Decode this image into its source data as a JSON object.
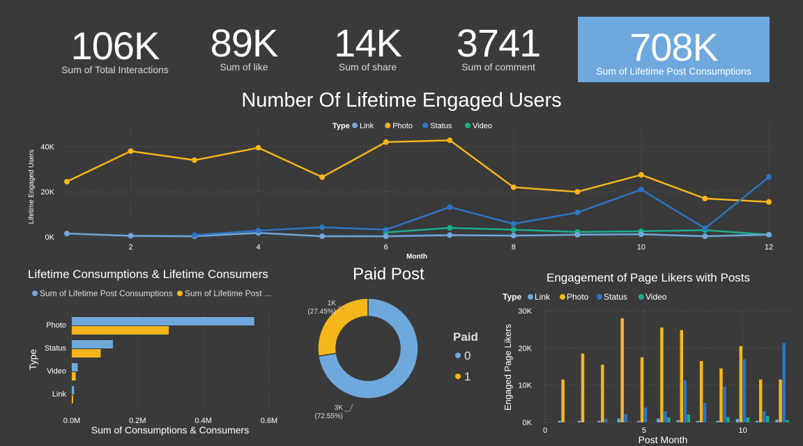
{
  "kpis": [
    {
      "value": "106K",
      "label": "Sum of Total Interactions"
    },
    {
      "value": "89K",
      "label": "Sum of like"
    },
    {
      "value": "14K",
      "label": "Sum of share"
    },
    {
      "value": "3741",
      "label": "Sum of comment"
    },
    {
      "value": "708K",
      "label": "Sum of Lifetime Post Consumptions"
    }
  ],
  "colors": {
    "background": "#3a3a3a",
    "link": "#6fa8dc",
    "photo": "#f4b61a",
    "status": "#2e75c2",
    "video": "#1aae8c",
    "kpi_highlight": "#6fa8dc"
  },
  "line_chart": {
    "title": "Number Of Lifetime Engaged Users",
    "legend_title": "Type",
    "xlabel": "Month",
    "ylabel": "Lifetime Engaged Users",
    "y_ticks": [
      "0K",
      "20K",
      "40K"
    ],
    "x_ticks": [
      "2",
      "4",
      "6",
      "8",
      "10",
      "12"
    ]
  },
  "bar_chart": {
    "title": "Lifetime Consumptions & Lifetime Consumers",
    "legend": [
      "Sum of Lifetime Post Consumptions",
      "Sum of Lifetime Post ..."
    ],
    "xlabel": "Sum of Consumptions & Consumers",
    "ylabel": "Type",
    "x_ticks": [
      "0.0M",
      "0.2M",
      "0.4M",
      "0.6M"
    ]
  },
  "donut": {
    "title": "Paid Post",
    "legend_title": "Paid",
    "legend_items": [
      "0",
      "1"
    ],
    "label_small_value": "1K",
    "label_small_pct": "(27.45%)",
    "label_big_value": "3K",
    "label_big_pct": "(72.55%)"
  },
  "column_chart": {
    "title": "Engagement of Page Likers with Posts",
    "legend_title": "Type",
    "xlabel": "Post Month",
    "ylabel": "Engaged Page Likers",
    "y_ticks": [
      "0K",
      "10K",
      "20K",
      "30K"
    ],
    "x_ticks": [
      "0",
      "5",
      "10"
    ]
  },
  "series_names": [
    "Link",
    "Photo",
    "Status",
    "Video"
  ],
  "chart_data": [
    {
      "type": "line",
      "title": "Number Of Lifetime Engaged Users",
      "xlabel": "Month",
      "ylabel": "Lifetime Engaged Users",
      "x": [
        1,
        2,
        3,
        4,
        5,
        6,
        7,
        8,
        9,
        10,
        11,
        12
      ],
      "ylim": [
        0,
        50000
      ],
      "series": [
        {
          "name": "Link",
          "x": [
            1,
            2,
            3,
            4,
            5,
            6,
            7,
            8,
            9,
            10,
            11,
            12
          ],
          "values": [
            1500,
            500,
            300,
            1800,
            300,
            300,
            800,
            600,
            1000,
            1200,
            300,
            1000
          ]
        },
        {
          "name": "Photo",
          "x": [
            1,
            2,
            3,
            4,
            5,
            6,
            7,
            8,
            9,
            10,
            11,
            12
          ],
          "values": [
            24500,
            38000,
            34000,
            39500,
            26500,
            42000,
            42800,
            22000,
            20000,
            27500,
            17000,
            15500
          ]
        },
        {
          "name": "Status",
          "x": [
            3,
            4,
            5,
            6,
            7,
            8,
            9,
            10,
            11,
            12
          ],
          "values": [
            800,
            2800,
            4300,
            3200,
            13200,
            5800,
            10800,
            21000,
            3800,
            26500
          ]
        },
        {
          "name": "Video",
          "x": [
            6,
            7,
            8,
            9,
            10,
            11,
            12
          ],
          "values": [
            2000,
            4000,
            3200,
            2200,
            2500,
            3000,
            1000
          ]
        }
      ]
    },
    {
      "type": "bar",
      "title": "Lifetime Consumptions & Lifetime Consumers",
      "categories": [
        "Photo",
        "Status",
        "Video",
        "Link"
      ],
      "xlabel": "Sum of Consumptions & Consumers",
      "ylabel": "Type",
      "xlim": [
        0,
        0.6
      ],
      "series": [
        {
          "name": "Sum of Lifetime Post Consumptions",
          "values": [
            0.555,
            0.125,
            0.018,
            0.007
          ]
        },
        {
          "name": "Sum of Lifetime Post ...",
          "values": [
            0.295,
            0.088,
            0.012,
            0.004
          ]
        }
      ]
    },
    {
      "type": "pie",
      "title": "Paid Post",
      "categories": [
        "0",
        "1"
      ],
      "values": [
        72.55,
        27.45
      ],
      "labels": [
        "3K (72.55%)",
        "1K (27.45%)"
      ]
    },
    {
      "type": "bar",
      "title": "Engagement of Page Likers with Posts",
      "xlabel": "Post Month",
      "ylabel": "Engaged Page Likers",
      "x": [
        1,
        2,
        3,
        4,
        5,
        6,
        7,
        8,
        9,
        10,
        11,
        12
      ],
      "ylim": [
        0,
        30000
      ],
      "series": [
        {
          "name": "Link",
          "values": [
            400,
            400,
            400,
            1000,
            400,
            1000,
            600,
            400,
            400,
            900,
            400,
            700
          ]
        },
        {
          "name": "Photo",
          "values": [
            11500,
            18500,
            15500,
            28000,
            17500,
            25500,
            24800,
            16500,
            14500,
            20500,
            11500,
            11500
          ]
        },
        {
          "name": "Status",
          "values": [
            0,
            0,
            1000,
            2200,
            4000,
            3000,
            11300,
            5200,
            9600,
            17000,
            3000,
            21300
          ]
        },
        {
          "name": "Video",
          "values": [
            0,
            0,
            0,
            0,
            0,
            1300,
            2100,
            0,
            1400,
            1300,
            1700,
            600
          ]
        }
      ]
    }
  ]
}
